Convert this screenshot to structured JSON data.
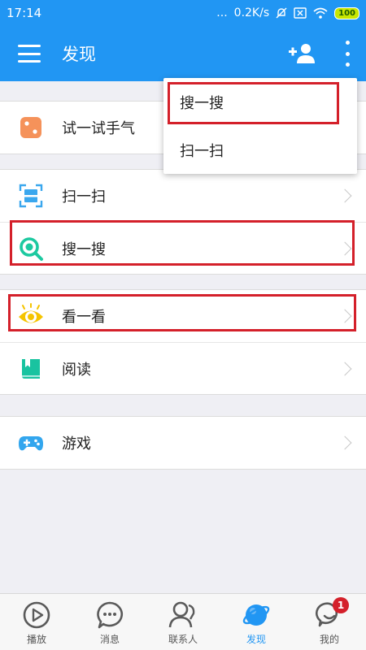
{
  "status_bar": {
    "time": "17:14",
    "dots": "...",
    "speed": "0.2K/s",
    "battery": "100"
  },
  "app_bar": {
    "title": "发现",
    "icons": [
      "menu-icon",
      "add-friend-icon",
      "more-vert-icon"
    ]
  },
  "items": [
    {
      "label": "试一试手气",
      "icon": "dice-icon"
    },
    {
      "label": "扫一扫",
      "icon": "scan-icon"
    },
    {
      "label": "搜一搜",
      "icon": "search-icon"
    },
    {
      "label": "看一看",
      "icon": "eye-icon"
    },
    {
      "label": "阅读",
      "icon": "book-icon"
    },
    {
      "label": "游戏",
      "icon": "gamepad-icon"
    }
  ],
  "popup_menu": {
    "items": [
      {
        "label": "搜一搜"
      },
      {
        "label": "扫一扫"
      }
    ]
  },
  "tabs": [
    {
      "label": "播放",
      "icon": "play-icon"
    },
    {
      "label": "消息",
      "icon": "message-icon"
    },
    {
      "label": "联系人",
      "icon": "contacts-icon"
    },
    {
      "label": "发现",
      "icon": "discover-planet-icon",
      "active": true
    },
    {
      "label": "我的",
      "icon": "profile-icon",
      "badge": "1"
    }
  ],
  "colors": {
    "primary": "#2196f3",
    "highlight_box": "#d4202a",
    "dice": "#f5925a",
    "scan": "#3aa7ee",
    "search": "#1cc9a0",
    "eye": "#f5c400",
    "book": "#19c3a0",
    "gamepad": "#32a6ee"
  }
}
